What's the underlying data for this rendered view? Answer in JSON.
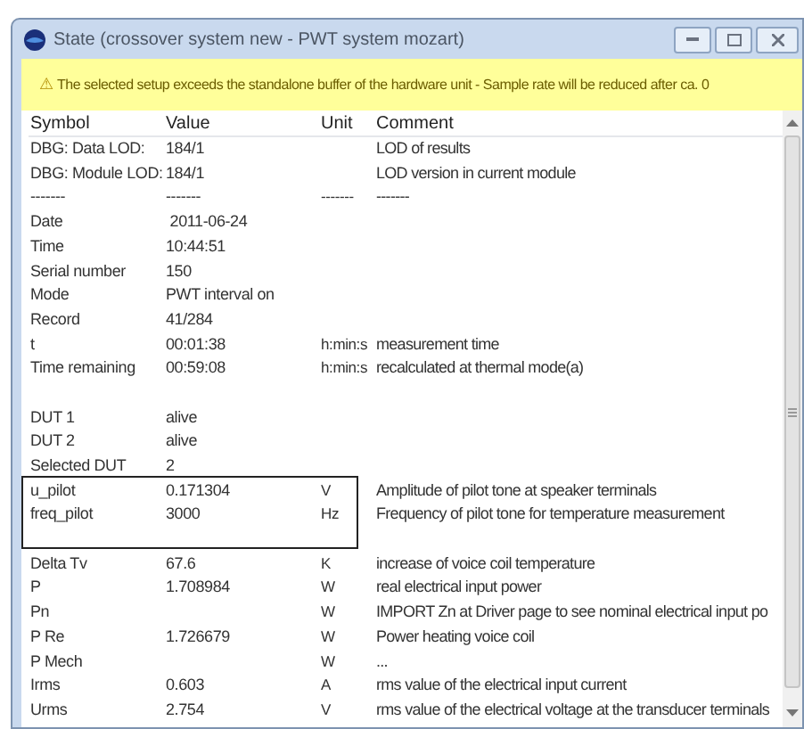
{
  "window": {
    "title": "State (crossover system new - PWT system mozart)"
  },
  "warning": {
    "icon": "⚠",
    "text": "The selected setup exceeds the standalone buffer of the hardware unit - Sample rate will be reduced after ca. 0"
  },
  "table": {
    "columns": [
      "Symbol",
      "Value",
      "Unit",
      "Comment"
    ],
    "rows": [
      {
        "kind": "data",
        "symbol": "DBG: Data LOD:",
        "value": "184/1",
        "comment": "LOD of results"
      },
      {
        "kind": "data",
        "symbol": "DBG: Module LOD:",
        "value": "184/1",
        "comment": "LOD version in current module"
      },
      {
        "kind": "data",
        "symbol": "-------",
        "value": "-------",
        "unit": "-------",
        "comment": "-------"
      },
      {
        "kind": "data",
        "symbol": "Date",
        "value": " 2011-06-24"
      },
      {
        "kind": "data",
        "symbol": "Time",
        "value": "10:44:51"
      },
      {
        "kind": "data",
        "symbol": "Serial number",
        "value": "150"
      },
      {
        "kind": "data",
        "symbol": "Mode",
        "value": "PWT interval on"
      },
      {
        "kind": "data",
        "symbol": "Record",
        "value": "41/284"
      },
      {
        "kind": "data",
        "symbol": "t",
        "value": "00:01:38",
        "unit": "h:min:s",
        "comment": "measurement time"
      },
      {
        "kind": "data",
        "symbol": "Time remaining",
        "value": "00:59:08",
        "unit": "h:min:s",
        "comment": "recalculated at thermal mode(a)"
      },
      {
        "kind": "blank"
      },
      {
        "kind": "data",
        "symbol": "DUT 1",
        "value": "alive"
      },
      {
        "kind": "data",
        "symbol": "DUT 2",
        "value": "alive"
      },
      {
        "kind": "data",
        "symbol": "Selected DUT",
        "value": "2"
      },
      {
        "kind": "data",
        "symbol": "u_pilot",
        "value": "0.171304",
        "unit": "V",
        "comment": "Amplitude of pilot tone at speaker terminals"
      },
      {
        "kind": "data",
        "symbol": "freq_pilot",
        "value": "3000",
        "unit": "Hz",
        "comment": "Frequency of pilot tone for temperature measurement"
      },
      {
        "kind": "blank"
      },
      {
        "kind": "data",
        "symbol": "Delta Tv",
        "value": "67.6",
        "unit": "K",
        "comment": "increase of voice coil temperature"
      },
      {
        "kind": "data",
        "symbol": "P",
        "value": "1.708984",
        "unit": "W",
        "comment": "real electrical input power"
      },
      {
        "kind": "data",
        "symbol": "Pn",
        "unit": "W",
        "comment": "IMPORT Zn at Driver page to see nominal electrical input po"
      },
      {
        "kind": "data",
        "symbol": "P Re",
        "value": "1.726679",
        "unit": "W",
        "comment": "Power heating voice coil"
      },
      {
        "kind": "data",
        "symbol": "P Mech",
        "unit": "W",
        "comment": "..."
      },
      {
        "kind": "data",
        "symbol": "Irms",
        "value": "0.603",
        "unit": "A",
        "comment": "rms value of the electrical input current"
      },
      {
        "kind": "data",
        "symbol": "Urms",
        "value": "2.754",
        "unit": "V",
        "comment": "rms value of the electrical voltage at the transducer terminals"
      }
    ]
  }
}
